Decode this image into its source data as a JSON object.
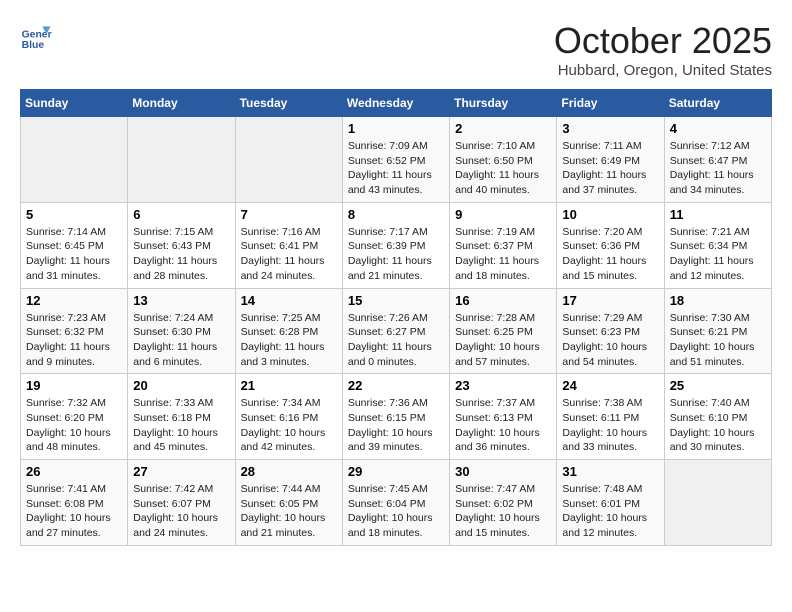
{
  "header": {
    "logo_line1": "General",
    "logo_line2": "Blue",
    "month": "October 2025",
    "location": "Hubbard, Oregon, United States"
  },
  "days_of_week": [
    "Sunday",
    "Monday",
    "Tuesday",
    "Wednesday",
    "Thursday",
    "Friday",
    "Saturday"
  ],
  "weeks": [
    [
      {
        "day": "",
        "content": ""
      },
      {
        "day": "",
        "content": ""
      },
      {
        "day": "",
        "content": ""
      },
      {
        "day": "1",
        "content": "Sunrise: 7:09 AM\nSunset: 6:52 PM\nDaylight: 11 hours and 43 minutes."
      },
      {
        "day": "2",
        "content": "Sunrise: 7:10 AM\nSunset: 6:50 PM\nDaylight: 11 hours and 40 minutes."
      },
      {
        "day": "3",
        "content": "Sunrise: 7:11 AM\nSunset: 6:49 PM\nDaylight: 11 hours and 37 minutes."
      },
      {
        "day": "4",
        "content": "Sunrise: 7:12 AM\nSunset: 6:47 PM\nDaylight: 11 hours and 34 minutes."
      }
    ],
    [
      {
        "day": "5",
        "content": "Sunrise: 7:14 AM\nSunset: 6:45 PM\nDaylight: 11 hours and 31 minutes."
      },
      {
        "day": "6",
        "content": "Sunrise: 7:15 AM\nSunset: 6:43 PM\nDaylight: 11 hours and 28 minutes."
      },
      {
        "day": "7",
        "content": "Sunrise: 7:16 AM\nSunset: 6:41 PM\nDaylight: 11 hours and 24 minutes."
      },
      {
        "day": "8",
        "content": "Sunrise: 7:17 AM\nSunset: 6:39 PM\nDaylight: 11 hours and 21 minutes."
      },
      {
        "day": "9",
        "content": "Sunrise: 7:19 AM\nSunset: 6:37 PM\nDaylight: 11 hours and 18 minutes."
      },
      {
        "day": "10",
        "content": "Sunrise: 7:20 AM\nSunset: 6:36 PM\nDaylight: 11 hours and 15 minutes."
      },
      {
        "day": "11",
        "content": "Sunrise: 7:21 AM\nSunset: 6:34 PM\nDaylight: 11 hours and 12 minutes."
      }
    ],
    [
      {
        "day": "12",
        "content": "Sunrise: 7:23 AM\nSunset: 6:32 PM\nDaylight: 11 hours and 9 minutes."
      },
      {
        "day": "13",
        "content": "Sunrise: 7:24 AM\nSunset: 6:30 PM\nDaylight: 11 hours and 6 minutes."
      },
      {
        "day": "14",
        "content": "Sunrise: 7:25 AM\nSunset: 6:28 PM\nDaylight: 11 hours and 3 minutes."
      },
      {
        "day": "15",
        "content": "Sunrise: 7:26 AM\nSunset: 6:27 PM\nDaylight: 11 hours and 0 minutes."
      },
      {
        "day": "16",
        "content": "Sunrise: 7:28 AM\nSunset: 6:25 PM\nDaylight: 10 hours and 57 minutes."
      },
      {
        "day": "17",
        "content": "Sunrise: 7:29 AM\nSunset: 6:23 PM\nDaylight: 10 hours and 54 minutes."
      },
      {
        "day": "18",
        "content": "Sunrise: 7:30 AM\nSunset: 6:21 PM\nDaylight: 10 hours and 51 minutes."
      }
    ],
    [
      {
        "day": "19",
        "content": "Sunrise: 7:32 AM\nSunset: 6:20 PM\nDaylight: 10 hours and 48 minutes."
      },
      {
        "day": "20",
        "content": "Sunrise: 7:33 AM\nSunset: 6:18 PM\nDaylight: 10 hours and 45 minutes."
      },
      {
        "day": "21",
        "content": "Sunrise: 7:34 AM\nSunset: 6:16 PM\nDaylight: 10 hours and 42 minutes."
      },
      {
        "day": "22",
        "content": "Sunrise: 7:36 AM\nSunset: 6:15 PM\nDaylight: 10 hours and 39 minutes."
      },
      {
        "day": "23",
        "content": "Sunrise: 7:37 AM\nSunset: 6:13 PM\nDaylight: 10 hours and 36 minutes."
      },
      {
        "day": "24",
        "content": "Sunrise: 7:38 AM\nSunset: 6:11 PM\nDaylight: 10 hours and 33 minutes."
      },
      {
        "day": "25",
        "content": "Sunrise: 7:40 AM\nSunset: 6:10 PM\nDaylight: 10 hours and 30 minutes."
      }
    ],
    [
      {
        "day": "26",
        "content": "Sunrise: 7:41 AM\nSunset: 6:08 PM\nDaylight: 10 hours and 27 minutes."
      },
      {
        "day": "27",
        "content": "Sunrise: 7:42 AM\nSunset: 6:07 PM\nDaylight: 10 hours and 24 minutes."
      },
      {
        "day": "28",
        "content": "Sunrise: 7:44 AM\nSunset: 6:05 PM\nDaylight: 10 hours and 21 minutes."
      },
      {
        "day": "29",
        "content": "Sunrise: 7:45 AM\nSunset: 6:04 PM\nDaylight: 10 hours and 18 minutes."
      },
      {
        "day": "30",
        "content": "Sunrise: 7:47 AM\nSunset: 6:02 PM\nDaylight: 10 hours and 15 minutes."
      },
      {
        "day": "31",
        "content": "Sunrise: 7:48 AM\nSunset: 6:01 PM\nDaylight: 10 hours and 12 minutes."
      },
      {
        "day": "",
        "content": ""
      }
    ]
  ]
}
